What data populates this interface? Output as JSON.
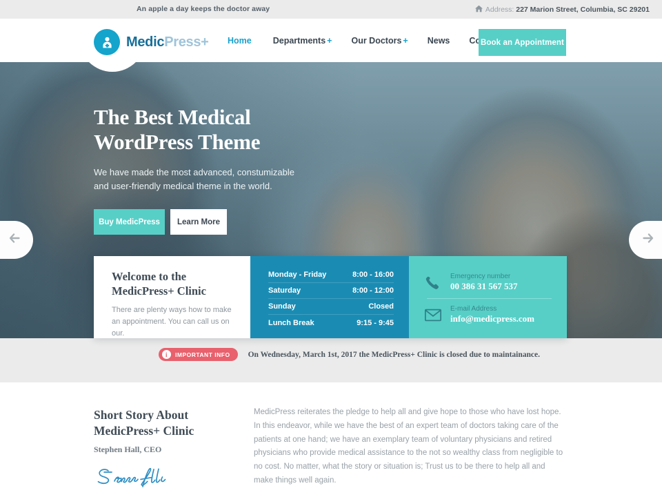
{
  "topbar": {
    "tagline": "An apple a day keeps the doctor away",
    "address_label": "Address:",
    "address_value": "227 Marion Street, Columbia, SC 29201",
    "home_icon": "home-icon"
  },
  "header": {
    "logo": {
      "icon": "doctor-avatar-icon",
      "part1": "Medic",
      "part2": "Press+"
    },
    "nav": [
      {
        "label": "Home",
        "active": true,
        "has_dropdown": false
      },
      {
        "label": "Departments",
        "active": false,
        "has_dropdown": true,
        "plus": "+"
      },
      {
        "label": "Our Doctors",
        "active": false,
        "has_dropdown": true,
        "plus": "+"
      },
      {
        "label": "News",
        "active": false,
        "has_dropdown": false
      },
      {
        "label": "Contact Us",
        "active": false,
        "has_dropdown": false
      }
    ],
    "cta": "Book an Appointment"
  },
  "hero": {
    "title_line1": "The Best Medical",
    "title_line2": "WordPress Theme",
    "subtitle": "We have made the most advanced, constumizable and user-friendly medical theme in the world.",
    "buttons": {
      "primary": "Buy MedicPress",
      "secondary": "Learn More"
    },
    "prev_icon": "arrow-left-icon",
    "next_icon": "arrow-right-icon"
  },
  "welcome_panel": {
    "title_line1": "Welcome to the",
    "title_line2": "MedicPress+ Clinic",
    "text": "There are plenty ways how to make an appointment. You can call us on our."
  },
  "hours_panel": {
    "rows": [
      {
        "day": "Monday - Friday",
        "time": "8:00 - 16:00"
      },
      {
        "day": "Saturday",
        "time": "8:00 - 12:00"
      },
      {
        "day": "Sunday",
        "time": "Closed"
      },
      {
        "day": "Lunch Break",
        "time": "9:15 - 9:45"
      }
    ]
  },
  "contact_panel": {
    "phone": {
      "icon": "phone-icon",
      "label": "Emergency number",
      "value": "00 386 31 567 537"
    },
    "email": {
      "icon": "envelope-icon",
      "label": "E-mail Address",
      "value": "info@medicpress.com"
    }
  },
  "info_strip": {
    "badge_icon": "info-circle-icon",
    "badge_label": "IMPORTANT INFO",
    "message": "On Wednesday, March 1st, 2017 the MedicPress+ Clinic is closed due to maintainance."
  },
  "story": {
    "title_line1": "Short Story About",
    "title_line2": "MedicPress+ Clinic",
    "role": "Stephen Hall, CEO",
    "signature_text": "Steven Hall",
    "body": "MedicPress reiterates the pledge to help all and give hope to those who have lost hope. In this endeavor, while we have the best of an expert team of doctors taking care of the patients at one hand; we have an exemplary team of voluntary physicians and retired physicians who provide medical assistance to the not so wealthy class from negligible to no cost. No matter, what the story or situation is; Trust us to be there to help all and make things well again."
  },
  "colors": {
    "teal": "#57cfc7",
    "blue": "#1a8cb4",
    "logo_blue": "#176f99",
    "accent_link": "#19a1cc",
    "alert_red": "#e8616d",
    "topbar_bg": "#ebebeb",
    "text_dark": "#3f4b55",
    "text_muted": "#98a1a8"
  }
}
